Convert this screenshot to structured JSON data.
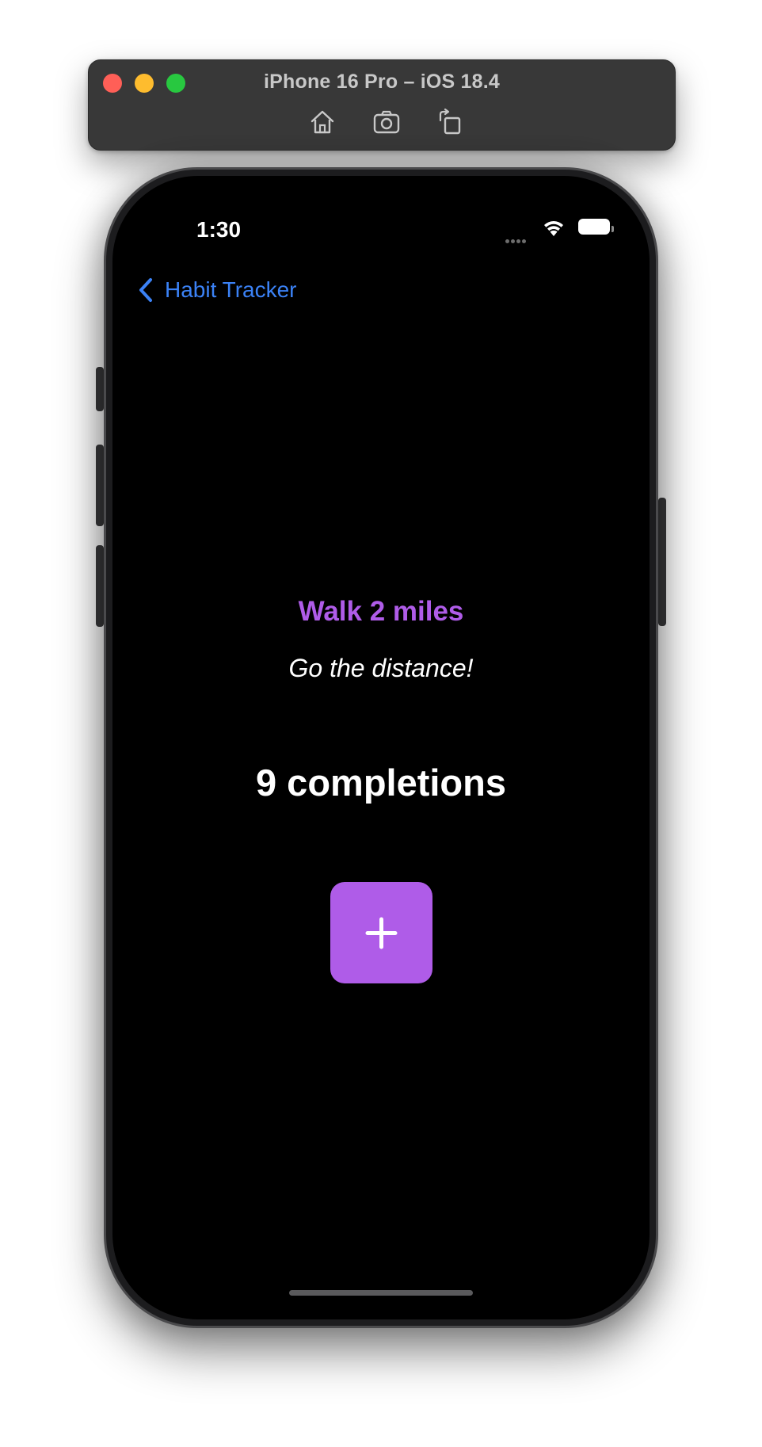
{
  "simulator": {
    "title": "iPhone 16 Pro – iOS 18.4",
    "tools": [
      "home-icon",
      "screenshot-icon",
      "rotate-icon"
    ]
  },
  "status_bar": {
    "time": "1:30"
  },
  "nav": {
    "back_label": "Habit Tracker"
  },
  "habit": {
    "title": "Walk 2 miles",
    "description": "Go the distance!",
    "completions_text": "9 completions"
  },
  "colors": {
    "accent": "#af5ce8",
    "link": "#3b82f6",
    "background": "#000000"
  }
}
